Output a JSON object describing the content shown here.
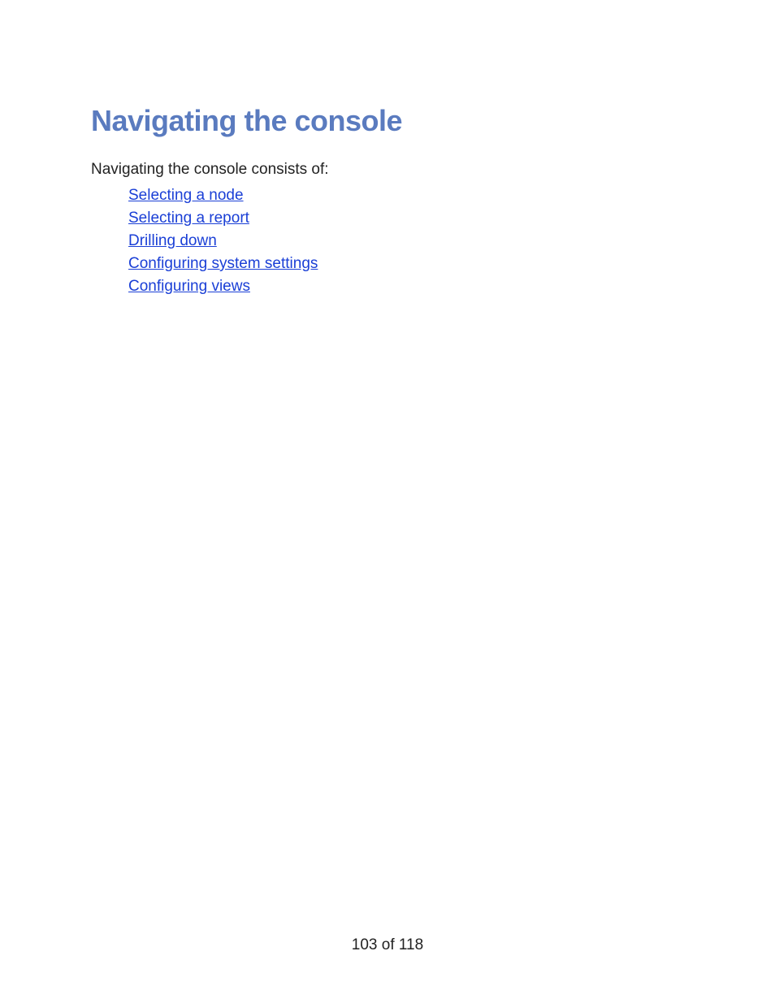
{
  "heading": "Navigating the console",
  "intro": "Navigating the console consists of:",
  "links": [
    "Selecting a node",
    "Selecting a report",
    "Drilling down",
    "Configuring system settings",
    "Configuring views"
  ],
  "footer": "103 of 118"
}
